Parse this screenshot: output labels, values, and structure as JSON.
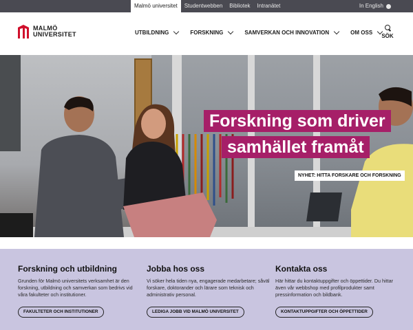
{
  "topbar": {
    "links": [
      "Malmö universitet",
      "Studentwebben",
      "Bibliotek",
      "Intranätet"
    ],
    "active_index": 0,
    "language": "In English",
    "language_icon": "globe-icon"
  },
  "header": {
    "logo_line1": "MALMÖ",
    "logo_line2": "UNIVERSITET",
    "logo_icon": "university-logo-icon",
    "nav": [
      "UTBILDNING",
      "FORSKNING",
      "SAMVERKAN OCH INNOVATION",
      "OM OSS"
    ],
    "search_label": "SÖK",
    "search_icon": "search-icon"
  },
  "hero": {
    "headline_line1": "Forskning som driver",
    "headline_line2": "samhället framåt",
    "news_tag": "NYHET: HITTA FORSKARE OCH FORSKNING"
  },
  "info": {
    "columns": [
      {
        "title": "Forskning och utbildning",
        "text": "Grunden för Malmö universitets verksamhet är den forskning, utbildning och samverkan som bedrivs vid våra fakulteter och institutioner.",
        "button": "FAKULTETER OCH INSTITUTIONER"
      },
      {
        "title": "Jobba hos oss",
        "text": "Vi söker hela tiden nya, engagerade medarbetare; såväl forskare, doktorander och lärare som teknisk och administrativ personal.",
        "button": "LEDIGA JOBB VID MALMÖ UNIVERSITET"
      },
      {
        "title": "Kontakta oss",
        "text": "Här hittar du kontaktuppgifter och öppettider. Du hittar även vår webbshop med profilprodukter samt pressinformation och bildbank.",
        "button": "KONTAKTUPPGIFTER OCH ÖPPETTIDER"
      }
    ]
  },
  "colors": {
    "topbar": "#4a4a52",
    "brand_red": "#d0102c",
    "headline_bg": "#a61f68",
    "info_bg": "#c9c5e0"
  }
}
